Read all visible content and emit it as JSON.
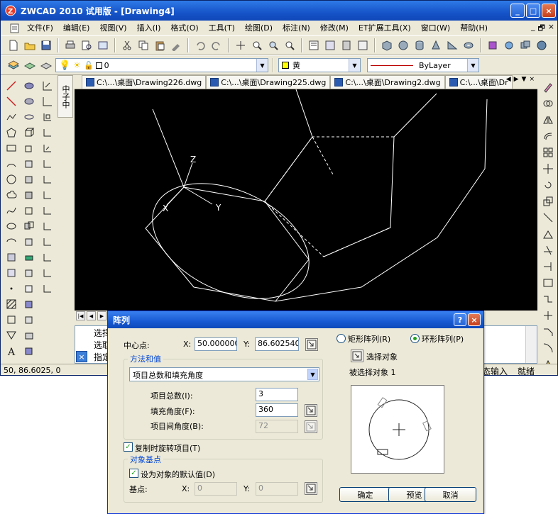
{
  "window": {
    "title": "ZWCAD 2010 试用版 - [Drawing4]",
    "buttons": {
      "minimize": "_",
      "maximize": "□",
      "close": "×"
    }
  },
  "menu": {
    "items": [
      "文件(F)",
      "编辑(E)",
      "视图(V)",
      "插入(I)",
      "格式(O)",
      "工具(T)",
      "绘图(D)",
      "标注(N)",
      "修改(M)",
      "ET扩展工具(X)",
      "窗口(W)",
      "帮助(H)"
    ],
    "mdi_buttons": [
      "_",
      "🗗",
      "×"
    ]
  },
  "layer_toolbar": {
    "layer_value": "0",
    "color_value": "黄",
    "linetype_value": "ByLayer"
  },
  "side_tab": {
    "label": "中子中"
  },
  "doc_tabs": [
    {
      "label": "C:\\...\\桌面\\Drawing226.dwg"
    },
    {
      "label": "C:\\...\\桌面\\Drawing225.dwg"
    },
    {
      "label": "C:\\...\\桌面\\Drawing2.dwg"
    },
    {
      "label": "C:\\...\\桌面\\Dr"
    }
  ],
  "canvas": {
    "axis_labels": {
      "z": "Z",
      "x": "X",
      "y": "Y"
    }
  },
  "command_line": {
    "lines": [
      "选择",
      "选取",
      "指定"
    ]
  },
  "status": {
    "coordinates": "50,  86.6025,  0",
    "right_items": [
      "态输入",
      "就绪"
    ]
  },
  "dialog": {
    "title": "阵列",
    "help_button": "?",
    "close_button": "×",
    "center_point_label": "中心点:",
    "x_label": "X:",
    "y_label": "Y:",
    "center_x": "50.000000",
    "center_y": "86.602540",
    "rect_array_label": "矩形阵列(R)",
    "polar_array_label": "环形阵列(P)",
    "select_objects_label": "选择对象",
    "selected_count_label": "被选择对象 1",
    "method_group_title": "方法和值",
    "method_value": "项目总数和填充角度",
    "total_items_label": "项目总数(I):",
    "total_items_value": "3",
    "fill_angle_label": "填充角度(F):",
    "fill_angle_value": "360",
    "item_angle_label": "项目间角度(B):",
    "item_angle_value": "72",
    "rotate_items_label": "复制时旋转项目(T)",
    "base_group_title": "对象基点",
    "default_base_label": "设为对象的默认值(D)",
    "base_point_label": "基点:",
    "base_x_label": "X:",
    "base_y_label": "Y:",
    "base_x_value": "0",
    "base_y_value": "0",
    "ok_label": "确定",
    "preview_label": "预览",
    "cancel_label": "取消"
  }
}
